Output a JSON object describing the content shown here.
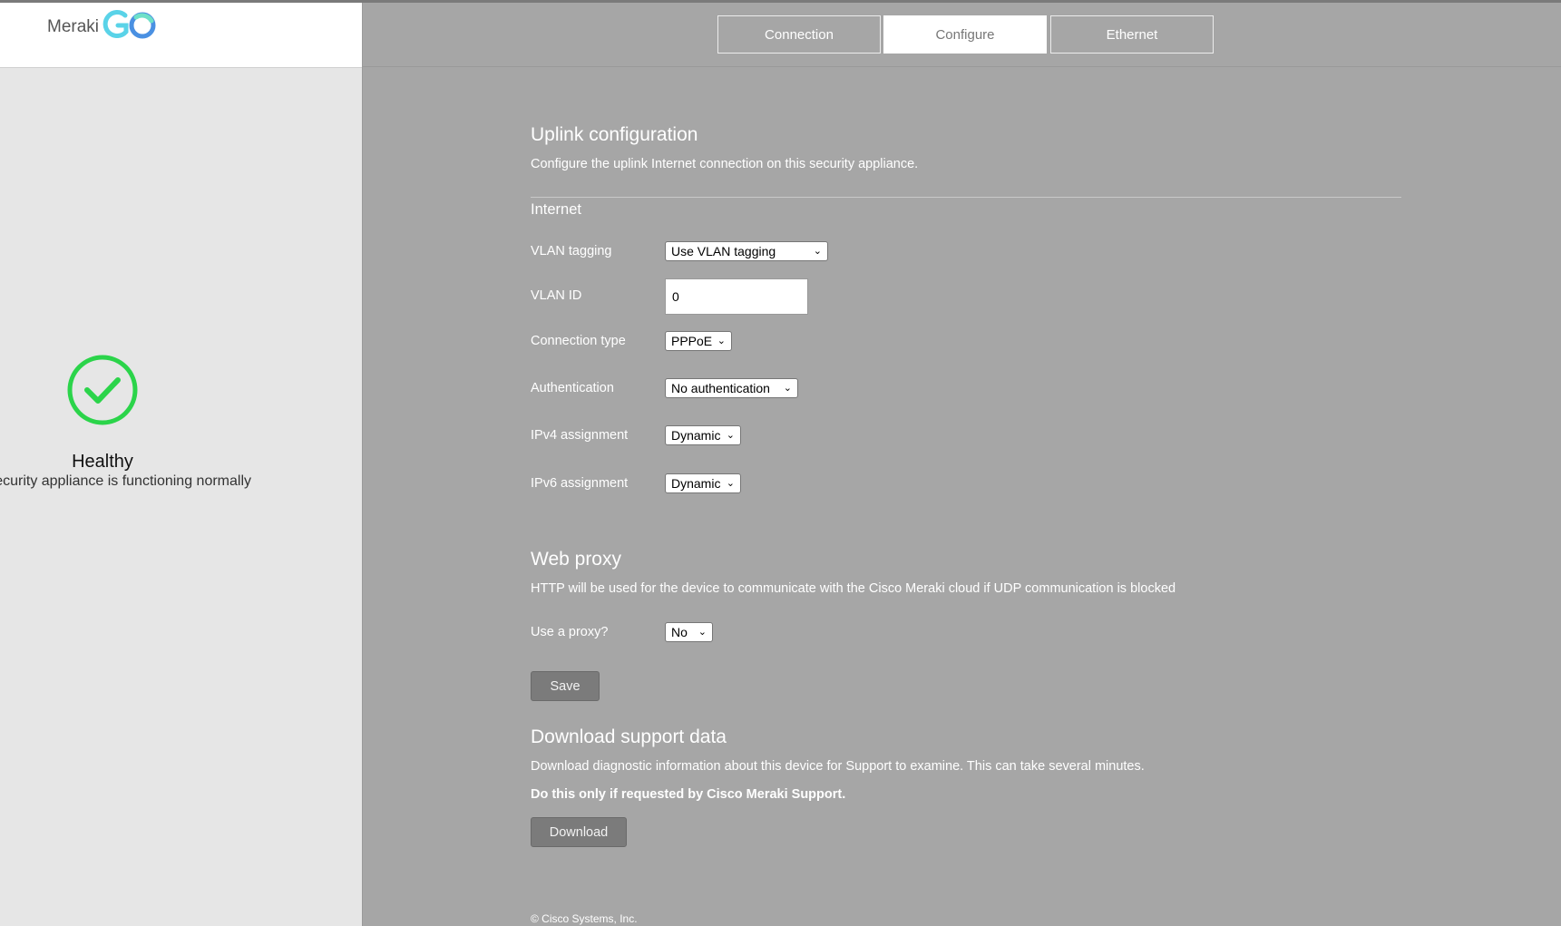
{
  "sidebar": {
    "logo_text": "Meraki",
    "status": {
      "title": "Healthy",
      "subtitle": "ecurity appliance is functioning normally",
      "color": "#2bd44a"
    }
  },
  "tabs": [
    {
      "label": "Connection",
      "active": false
    },
    {
      "label": "Configure",
      "active": true
    },
    {
      "label": "Ethernet",
      "active": false
    }
  ],
  "uplink": {
    "title": "Uplink configuration",
    "description": "Configure the uplink Internet connection on this security appliance.",
    "section": "Internet",
    "fields": {
      "vlan_tagging": {
        "label": "VLAN tagging",
        "value": "Use VLAN tagging"
      },
      "vlan_id": {
        "label": "VLAN ID",
        "value": "0"
      },
      "connection_type": {
        "label": "Connection type",
        "value": "PPPoE"
      },
      "authentication": {
        "label": "Authentication",
        "value": "No authentication"
      },
      "ipv4": {
        "label": "IPv4 assignment",
        "value": "Dynamic"
      },
      "ipv6": {
        "label": "IPv6 assignment",
        "value": "Dynamic"
      }
    }
  },
  "proxy": {
    "title": "Web proxy",
    "description": "HTTP will be used for the device to communicate with the Cisco Meraki cloud if UDP communication is blocked",
    "use_proxy": {
      "label": "Use a proxy?",
      "value": "No"
    },
    "save_label": "Save"
  },
  "support": {
    "title": "Download support data",
    "description": "Download diagnostic information about this device for Support to examine. This can take several minutes.",
    "warning": "Do this only if requested by Cisco Meraki Support.",
    "download_label": "Download"
  },
  "footer": "© Cisco Systems, Inc."
}
